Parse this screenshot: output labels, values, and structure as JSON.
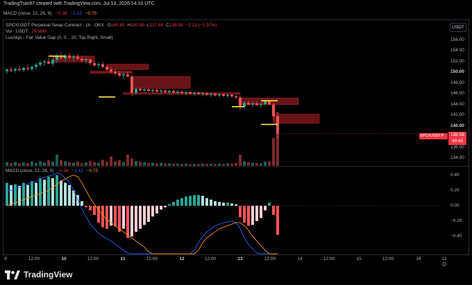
{
  "header": {
    "credit": "TradingTrav97 created with TradingView.com, Jul 13, 2026 14:10 UTC"
  },
  "macd_top": {
    "label": "MACD (close, 12, 26, 9)",
    "hist": "−0.38",
    "macd": "−1.12",
    "signal": "−0.75"
  },
  "legend": {
    "symbol": "SPCXUSDT Perpetual Swap Contract · 1h · OKX",
    "open_l": "O",
    "open": "140.80",
    "high_l": "H",
    "high": "140.95",
    "low_l": "L",
    "low": "137.60",
    "close_l": "C",
    "close": "138.58",
    "change": "−2.21 (−1.57%)",
    "vol_label": "Vol · USDT",
    "vol": "28.98M",
    "indicator": "LuxAlgo - Fair Value Gap (0, 0, , 20, Top Right, Small)"
  },
  "macd_pane": {
    "label": "MACD (close, 12, 26, 9)",
    "hist": "−0.38",
    "macd": "−1.12",
    "signal": "−0.75"
  },
  "currency_button": "USDT",
  "price_tag": {
    "symbol": "SPCXUSDT.P",
    "price": "138.58",
    "countdown": "49:43"
  },
  "price_axis": [
    "156.00",
    "154.00",
    "152.00",
    "150.00",
    "148.00",
    "146.00",
    "144.00",
    "142.00",
    "140.00",
    "136.00",
    "134.00"
  ],
  "price_axis_bold": [
    "150.00",
    "140.00"
  ],
  "macd_axis": [
    "0.40",
    "0.20",
    "0.00",
    "−0.20",
    "−0.40"
  ],
  "time_axis": [
    {
      "label": "9",
      "bold": false
    },
    {
      "label": "12:00",
      "bold": false
    },
    {
      "label": "10",
      "bold": true
    },
    {
      "label": "12:00",
      "bold": false
    },
    {
      "label": "11",
      "bold": true
    },
    {
      "label": "12:00",
      "bold": false
    },
    {
      "label": "12",
      "bold": true
    },
    {
      "label": "12:00",
      "bold": false
    },
    {
      "label": "13",
      "bold": true
    },
    {
      "label": "12:00",
      "bold": false
    },
    {
      "label": "14",
      "bold": false
    },
    {
      "label": "12:00",
      "bold": false
    },
    {
      "label": "15",
      "bold": false
    },
    {
      "label": "12:00",
      "bold": false
    },
    {
      "label": "16",
      "bold": false
    },
    {
      "label": "12",
      "bold": false
    }
  ],
  "brand": "TradingView",
  "colors": {
    "up": "#26a69a",
    "down": "#ef5350",
    "fvg": "#8b1a1f",
    "level": "#ffeb3b",
    "macd_line": "#2962ff",
    "signal_line": "#ff9800",
    "hist_pos_strong": "#26a69a",
    "hist_pos_weak": "#b2dfdb",
    "hist_neg_strong": "#ff5252",
    "hist_neg_weak": "#ffcdd2"
  },
  "chart_data": {
    "type": "candlestick",
    "price_range": [
      133,
      157.5
    ],
    "candles": [
      [
        150.2,
        150.8,
        149.7,
        150.5
      ],
      [
        150.5,
        151.0,
        150.0,
        150.3
      ],
      [
        150.3,
        150.9,
        149.9,
        150.6
      ],
      [
        150.6,
        151.2,
        150.1,
        150.4
      ],
      [
        150.4,
        151.0,
        150.0,
        150.8
      ],
      [
        150.8,
        151.5,
        150.3,
        150.6
      ],
      [
        150.6,
        151.3,
        150.2,
        151.0
      ],
      [
        151.0,
        151.8,
        150.6,
        151.4
      ],
      [
        151.4,
        152.2,
        150.9,
        151.8
      ],
      [
        151.8,
        152.4,
        151.2,
        152.0
      ],
      [
        152.0,
        152.8,
        151.5,
        151.6
      ],
      [
        151.6,
        152.5,
        151.0,
        152.3
      ],
      [
        152.3,
        153.5,
        151.8,
        153.0
      ],
      [
        153.0,
        153.8,
        152.3,
        152.6
      ],
      [
        152.6,
        153.4,
        152.0,
        153.1
      ],
      [
        153.1,
        153.6,
        152.4,
        152.7
      ],
      [
        152.7,
        153.3,
        152.1,
        152.9
      ],
      [
        152.9,
        153.4,
        152.2,
        152.5
      ],
      [
        152.5,
        153.0,
        151.8,
        152.2
      ],
      [
        152.2,
        152.8,
        151.6,
        152.4
      ],
      [
        152.4,
        152.6,
        151.3,
        151.7
      ],
      [
        151.7,
        152.1,
        151.0,
        151.3
      ],
      [
        151.3,
        151.9,
        150.8,
        151.5
      ],
      [
        151.5,
        152.0,
        150.7,
        151.0
      ],
      [
        151.0,
        151.4,
        150.2,
        150.5
      ],
      [
        150.5,
        151.0,
        149.8,
        150.1
      ],
      [
        150.1,
        150.6,
        149.4,
        149.8
      ],
      [
        149.8,
        150.3,
        149.0,
        149.4
      ],
      [
        149.4,
        150.0,
        148.8,
        149.6
      ],
      [
        149.6,
        150.2,
        149.0,
        149.2
      ],
      [
        149.2,
        149.5,
        145.6,
        146.2
      ],
      [
        146.2,
        147.3,
        145.8,
        146.9
      ],
      [
        146.9,
        147.2,
        146.4,
        146.6
      ],
      [
        146.6,
        147.0,
        146.2,
        146.8
      ],
      [
        146.8,
        147.1,
        146.4,
        146.5
      ],
      [
        146.5,
        146.9,
        146.1,
        146.7
      ],
      [
        146.7,
        147.0,
        146.3,
        146.4
      ],
      [
        146.4,
        146.9,
        146.0,
        146.6
      ],
      [
        146.6,
        146.9,
        146.2,
        146.3
      ],
      [
        146.3,
        146.8,
        145.9,
        146.5
      ],
      [
        146.5,
        146.8,
        146.1,
        146.2
      ],
      [
        146.2,
        146.7,
        145.8,
        146.4
      ],
      [
        146.4,
        146.7,
        146.0,
        146.1
      ],
      [
        146.1,
        146.6,
        145.7,
        146.3
      ],
      [
        146.3,
        146.6,
        145.9,
        146.0
      ],
      [
        146.0,
        146.5,
        145.6,
        146.2
      ],
      [
        146.2,
        146.5,
        145.8,
        145.9
      ],
      [
        145.9,
        146.4,
        145.5,
        146.1
      ],
      [
        146.1,
        146.3,
        145.6,
        145.8
      ],
      [
        145.8,
        146.2,
        145.4,
        146.0
      ],
      [
        146.0,
        146.2,
        145.5,
        145.7
      ],
      [
        145.7,
        146.1,
        145.3,
        145.9
      ],
      [
        145.9,
        146.1,
        145.4,
        145.6
      ],
      [
        145.6,
        146.0,
        145.2,
        145.8
      ],
      [
        145.8,
        146.0,
        145.3,
        145.5
      ],
      [
        145.5,
        145.8,
        145.0,
        145.3
      ],
      [
        145.3,
        145.6,
        142.9,
        143.6
      ],
      [
        143.6,
        144.6,
        143.2,
        144.3
      ],
      [
        144.3,
        144.7,
        143.8,
        144.0
      ],
      [
        144.0,
        144.5,
        143.5,
        144.2
      ],
      [
        144.2,
        144.6,
        143.7,
        143.9
      ],
      [
        143.9,
        144.4,
        143.4,
        144.1
      ],
      [
        144.1,
        144.9,
        143.7,
        144.6
      ],
      [
        144.6,
        144.8,
        143.9,
        144.0
      ],
      [
        144.0,
        144.3,
        141.0,
        141.8
      ],
      [
        141.8,
        142.0,
        137.6,
        138.6
      ]
    ],
    "volumes_musdt": [
      2,
      1.5,
      2,
      1.2,
      1.8,
      1.4,
      2.2,
      1.6,
      2.5,
      1.8,
      3,
      2.2,
      6,
      3,
      2.4,
      2,
      1.6,
      2.2,
      1.4,
      1.8,
      2.5,
      2,
      1.6,
      3.2,
      2.2,
      5,
      2.4,
      3,
      2,
      6,
      4,
      2.6,
      2.2,
      1.8,
      1.4,
      1.6,
      1.2,
      1.5,
      1.1,
      1.3,
      1,
      1.2,
      1,
      1.1,
      0.9,
      1,
      0.9,
      1.2,
      1,
      1.1,
      0.9,
      1.2,
      1,
      1.4,
      1.2,
      1.5,
      6,
      2.5,
      1.8,
      1.5,
      1.4,
      1.2,
      2.2,
      2.4,
      15,
      28.98
    ],
    "fvg_zones": [
      {
        "from": 153.0,
        "to": 151.9,
        "start": 11,
        "end": 21
      },
      {
        "from": 151.5,
        "to": 150.5,
        "start": 24,
        "end": 34
      },
      {
        "from": 150.2,
        "to": 149.8,
        "start": 20,
        "end": 30
      },
      {
        "from": 149.2,
        "to": 147.0,
        "start": 30,
        "end": 44
      },
      {
        "from": 146.2,
        "to": 145.9,
        "start": 28,
        "end": 56
      },
      {
        "from": 145.2,
        "to": 144.0,
        "start": 56,
        "end": 70
      },
      {
        "from": 142.2,
        "to": 140.5,
        "start": 64,
        "end": 75
      }
    ],
    "levels": [
      {
        "price": 153.0,
        "start": 10,
        "end": 14
      },
      {
        "price": 145.4,
        "start": 22,
        "end": 26
      },
      {
        "price": 143.6,
        "start": 54,
        "end": 57
      },
      {
        "price": 144.7,
        "start": 61,
        "end": 65
      },
      {
        "price": 140.3,
        "start": 61,
        "end": 65
      }
    ],
    "macd": {
      "range": [
        -0.5,
        0.45
      ],
      "hist": [
        0.3,
        0.27,
        0.28,
        0.26,
        0.3,
        0.27,
        0.32,
        0.3,
        0.36,
        0.34,
        0.38,
        0.36,
        0.4,
        0.33,
        0.3,
        0.27,
        0.2,
        0.14,
        0.06,
        -0.02,
        -0.06,
        -0.12,
        -0.22,
        -0.28,
        -0.3,
        -0.26,
        -0.27,
        -0.34,
        -0.3,
        -0.42,
        -0.4,
        -0.34,
        -0.3,
        -0.25,
        -0.21,
        -0.14,
        -0.1,
        -0.05,
        -0.02,
        0.02,
        0.05,
        0.08,
        0.1,
        0.12,
        0.13,
        0.14,
        0.14,
        0.13,
        0.1,
        0.08,
        0.06,
        0.05,
        0.04,
        0.04,
        0.03,
        0.02,
        -0.15,
        -0.22,
        -0.26,
        -0.25,
        -0.2,
        -0.16,
        -0.06,
        0.04,
        -0.12,
        -0.38
      ],
      "macd_line": [
        0.2,
        0.2,
        0.22,
        0.24,
        0.26,
        0.28,
        0.3,
        0.32,
        0.35,
        0.37,
        0.39,
        0.4,
        0.43,
        0.41,
        0.36,
        0.3,
        0.2,
        0.08,
        -0.04,
        -0.14,
        -0.24,
        -0.3,
        -0.36,
        -0.4,
        -0.43,
        -0.46,
        -0.5,
        -0.54,
        -0.58,
        -0.62,
        -0.66,
        -0.68,
        -0.7,
        -0.7,
        -0.7,
        -0.7,
        -0.7,
        -0.7,
        -0.7,
        -0.7,
        -0.7,
        -0.7,
        -0.7,
        -0.7,
        -0.7,
        -0.58,
        -0.48,
        -0.4,
        -0.34,
        -0.3,
        -0.26,
        -0.24,
        -0.22,
        -0.21,
        -0.2,
        -0.22,
        -0.3,
        -0.42,
        -0.5,
        -0.56,
        -0.62,
        -0.68,
        -0.74,
        -0.8,
        -0.95,
        -1.12
      ],
      "signal_line": [
        0.0,
        0.02,
        0.04,
        0.06,
        0.08,
        0.1,
        0.12,
        0.14,
        0.16,
        0.18,
        0.2,
        0.24,
        0.28,
        0.32,
        0.35,
        0.38,
        0.4,
        0.38,
        0.3,
        0.2,
        0.1,
        0.02,
        -0.06,
        -0.12,
        -0.18,
        -0.22,
        -0.26,
        -0.3,
        -0.34,
        -0.38,
        -0.42,
        -0.46,
        -0.5,
        -0.54,
        -0.6,
        -0.66,
        -0.7,
        -0.7,
        -0.7,
        -0.7,
        -0.7,
        -0.7,
        -0.7,
        -0.7,
        -0.7,
        -0.7,
        -0.58,
        -0.48,
        -0.42,
        -0.38,
        -0.34,
        -0.3,
        -0.28,
        -0.26,
        -0.24,
        -0.22,
        -0.22,
        -0.26,
        -0.32,
        -0.4,
        -0.46,
        -0.52,
        -0.58,
        -0.64,
        -0.7,
        -0.75
      ]
    }
  }
}
